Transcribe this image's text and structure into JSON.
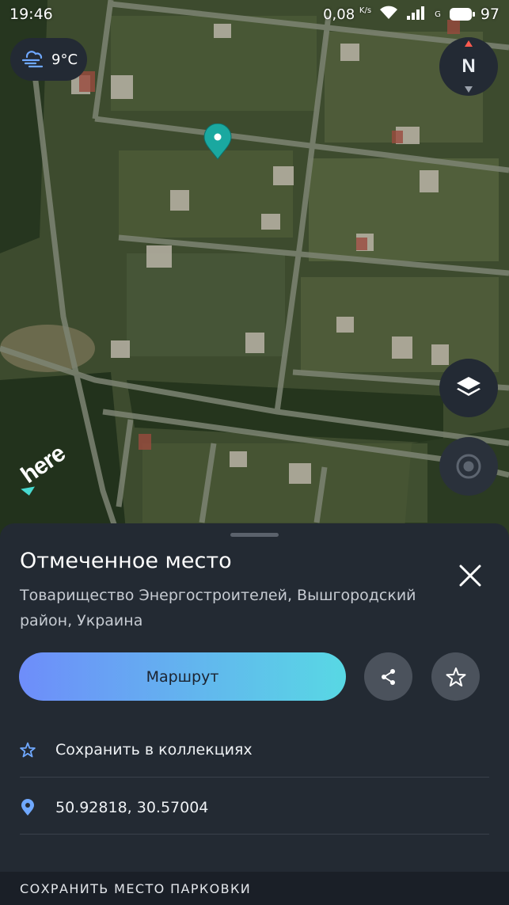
{
  "status_bar": {
    "time": "19:46",
    "net_speed": "0,08",
    "net_unit": "K/s",
    "signal_type": "G",
    "battery": "97"
  },
  "map": {
    "weather_temp": "9°C",
    "weather_icon": "wind-cloud-icon",
    "compass_label": "N",
    "brand": "here",
    "colors": {
      "pin": "#1aa8a0",
      "brand_accent": "#48dad0"
    }
  },
  "sheet": {
    "title": "Отмеченное место",
    "address": "Товарищество Энергостроителей, Вышгородский район, Украина",
    "route_label": "Маршрут",
    "route_gradient": [
      "#6e8dfa",
      "#58d8e4"
    ],
    "save_to_collections": "Сохранить в коллекциях",
    "coordinates": "50.92818, 30.57004",
    "save_parking": "СОХРАНИТЬ МЕСТО ПАРКОВКИ",
    "accent_color": "#6fa8ff"
  }
}
